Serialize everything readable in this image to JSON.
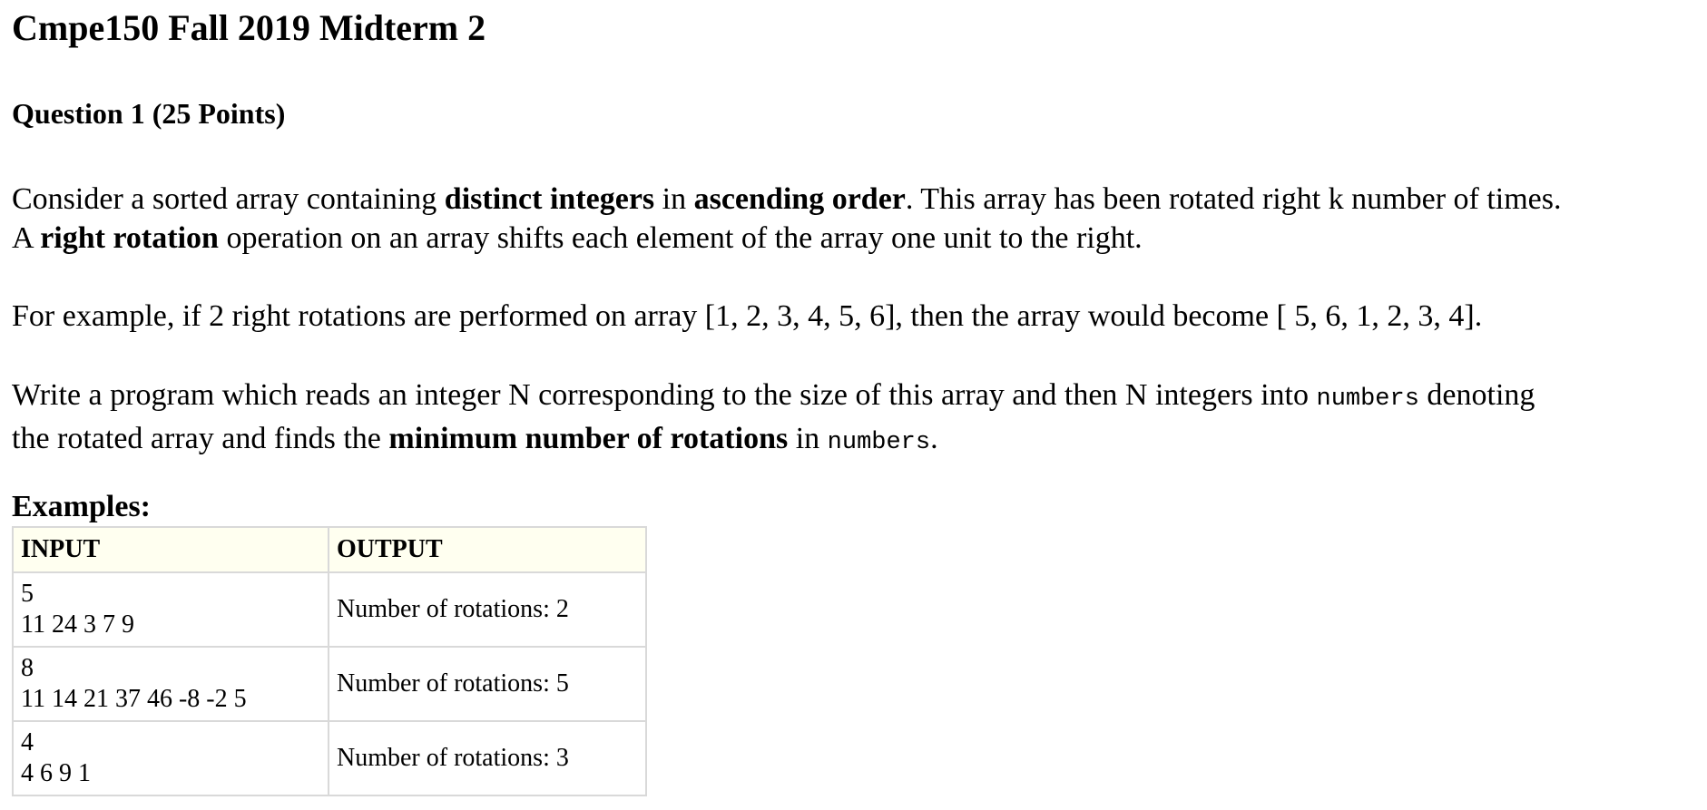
{
  "title": "Cmpe150 Fall 2019 Midterm 2",
  "question_title": "Question 1 (25 Points)",
  "paragraph1": {
    "line1": {
      "a": "Consider a sorted array containing ",
      "b": "distinct integers",
      "c": " in ",
      "d": "ascending order",
      "e": ". This array has been rotated right k number of times."
    },
    "line2": {
      "a": "A ",
      "b": "right rotation",
      "c": " operation on an array shifts each element of the array one unit to the right."
    }
  },
  "paragraph2": "For example, if 2 right rotations are performed on array [1, 2, 3, 4, 5, 6], then the array would become [ 5, 6, 1, 2, 3, 4].",
  "paragraph3": {
    "line1": {
      "a": "Write a program which reads an integer N corresponding to the size of this array and then N integers into ",
      "code": "numbers",
      "b": " denoting"
    },
    "line2": {
      "a": "the rotated array and finds the ",
      "b": "minimum number of rotations",
      "c": " in ",
      "code": "numbers",
      "d": "."
    }
  },
  "examples_heading": "Examples:",
  "table": {
    "headers": [
      "INPUT",
      "OUTPUT"
    ],
    "rows": [
      {
        "input_line1": "5",
        "input_line2": "11 24 3 7 9",
        "output": "Number of rotations: 2"
      },
      {
        "input_line1": "8",
        "input_line2": "11 14 21 37 46 -8 -2 5",
        "output": "Number of rotations: 5"
      },
      {
        "input_line1": "4",
        "input_line2": "4 6 9 1",
        "output": "Number of rotations: 3"
      }
    ]
  }
}
